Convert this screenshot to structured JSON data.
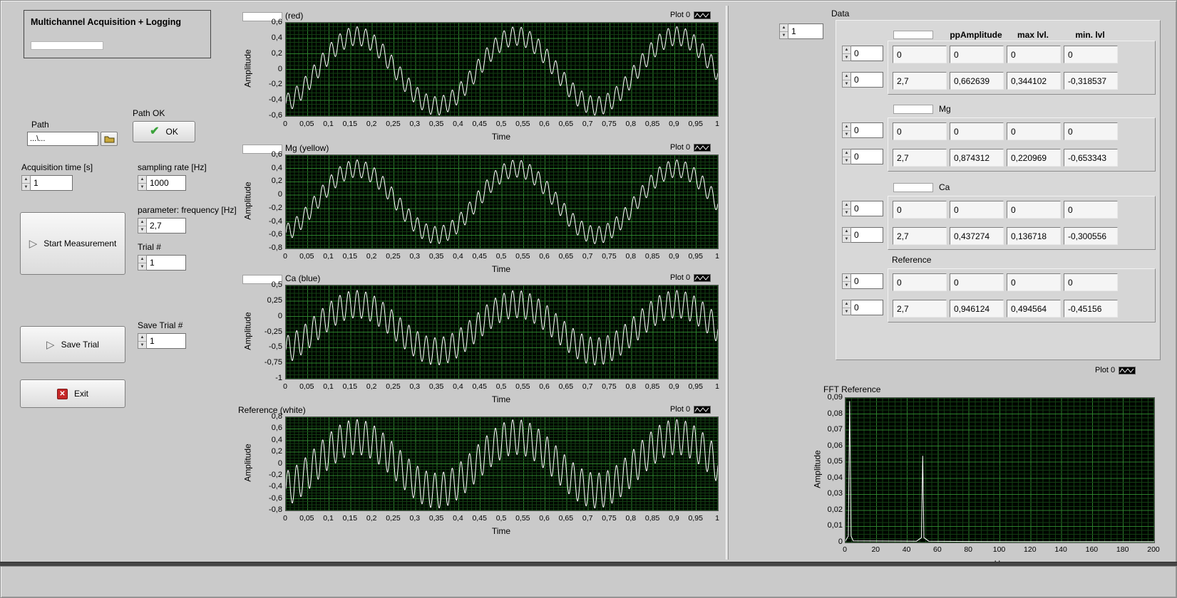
{
  "window": {
    "title": "Multichannel Acquisition + Logging"
  },
  "colors": {
    "panel_bg": "#cacaca",
    "plot_bg": "#000600",
    "grid_major": "#2c7e2c",
    "grid_minor": "#133d13",
    "waveform": "#ffffff",
    "exit_icon_red": "#c62828",
    "check_green": "#3aa23a"
  },
  "left_panel": {
    "path_label": "Path",
    "path_value": "...\\...",
    "path_ok_label": "Path OK",
    "ok_button_label": "OK",
    "acquisition_time_label": "Acquisition time [s]",
    "acquisition_time_value": "1",
    "sampling_rate_label": "sampling rate [Hz]",
    "sampling_rate_value": "1000",
    "frequency_label": "parameter: frequency [Hz]",
    "frequency_value": "2,7",
    "start_button_label": "Start Measurement",
    "trial_label": "Trial #",
    "trial_value": "1",
    "save_button_label": "Save Trial",
    "save_trial_label": "Save Trial #",
    "save_trial_value": "1",
    "exit_button_label": "Exit"
  },
  "data_panel": {
    "title": "Data",
    "channel_index_value": "1",
    "column_headers": [
      "ppAmplitude",
      "max lvl.",
      "min. lvl"
    ],
    "groups": [
      {
        "name": "",
        "name_box": false,
        "rows": [
          {
            "selector": "0",
            "values": [
              "0",
              "0",
              "0",
              "0"
            ]
          },
          {
            "selector": "0",
            "values": [
              "2,7",
              "0,662639",
              "0,344102",
              "-0,318537"
            ]
          }
        ]
      },
      {
        "name": "Mg",
        "name_box": true,
        "rows": [
          {
            "selector": "0",
            "values": [
              "0",
              "0",
              "0",
              "0"
            ]
          },
          {
            "selector": "0",
            "values": [
              "2,7",
              "0,874312",
              "0,220969",
              "-0,653343"
            ]
          }
        ]
      },
      {
        "name": "Ca",
        "name_box": true,
        "rows": [
          {
            "selector": "0",
            "values": [
              "0",
              "0",
              "0",
              "0"
            ]
          },
          {
            "selector": "0",
            "values": [
              "2,7",
              "0,437274",
              "0,136718",
              "-0,300556"
            ]
          }
        ]
      },
      {
        "name": "Reference",
        "name_box": false,
        "rows": [
          {
            "selector": "0",
            "values": [
              "0",
              "0",
              "0",
              "0"
            ]
          },
          {
            "selector": "0",
            "values": [
              "2,7",
              "0,946124",
              "0,494564",
              "-0,45156"
            ]
          }
        ]
      }
    ]
  },
  "chart_data": [
    {
      "id": "red-channel",
      "type": "line",
      "title": "(red)",
      "legend": "Plot 0",
      "xlabel": "Time",
      "ylabel": "Amplitude",
      "xlim": [
        0,
        1
      ],
      "ylim": [
        -0.6,
        0.6
      ],
      "ytick_labels": [
        "0,6",
        "0,4",
        "0,2",
        "0",
        "-0,2",
        "-0,4",
        "-0,6"
      ],
      "xtick_labels": [
        "0",
        "0,05",
        "0,1",
        "0,15",
        "0,2",
        "0,25",
        "0,3",
        "0,35",
        "0,4",
        "0,45",
        "0,5",
        "0,55",
        "0,6",
        "0,65",
        "0,7",
        "0,75",
        "0,8",
        "0,85",
        "0,9",
        "0,95",
        "1"
      ],
      "line_color": "#ffffff",
      "signal": {
        "f1": 2.7,
        "a1": 0.45,
        "phase1": -1.2,
        "f2": 50,
        "a2": 0.12,
        "offset": -0.02
      }
    },
    {
      "id": "mg-channel",
      "type": "line",
      "title": "Mg (yellow)",
      "legend": "Plot 0",
      "xlabel": "Time",
      "ylabel": "Amplitude",
      "xlim": [
        0,
        1
      ],
      "ylim": [
        -0.8,
        0.6
      ],
      "ytick_labels": [
        "0,6",
        "0,4",
        "0,2",
        "0",
        "-0,2",
        "-0,4",
        "-0,6",
        "-0,8"
      ],
      "xtick_labels": [
        "0",
        "0,05",
        "0,1",
        "0,15",
        "0,2",
        "0,25",
        "0,3",
        "0,35",
        "0,4",
        "0,45",
        "0,5",
        "0,55",
        "0,6",
        "0,65",
        "0,7",
        "0,75",
        "0,8",
        "0,85",
        "0,9",
        "0,95",
        "1"
      ],
      "line_color": "#ffffff",
      "signal": {
        "f1": 2.7,
        "a1": 0.5,
        "phase1": -1.2,
        "f2": 50,
        "a2": 0.13,
        "offset": -0.1
      }
    },
    {
      "id": "ca-channel",
      "type": "line",
      "title": "Ca (blue)",
      "legend": "Plot 0",
      "xlabel": "Time",
      "ylabel": "Amplitude",
      "xlim": [
        0,
        1
      ],
      "ylim": [
        -1,
        0.5
      ],
      "ytick_labels": [
        "0,5",
        "0,25",
        "0",
        "-0,25",
        "-0,5",
        "-0,75",
        "-1"
      ],
      "xtick_labels": [
        "0",
        "0,05",
        "0,1",
        "0,15",
        "0,2",
        "0,25",
        "0,3",
        "0,35",
        "0,4",
        "0,45",
        "0,5",
        "0,55",
        "0,6",
        "0,65",
        "0,7",
        "0,75",
        "0,8",
        "0,85",
        "0,9",
        "0,95",
        "1"
      ],
      "line_color": "#ffffff",
      "signal": {
        "f1": 2.7,
        "a1": 0.38,
        "phase1": -1.2,
        "f2": 50,
        "a2": 0.22,
        "offset": -0.18
      }
    },
    {
      "id": "reference-channel",
      "type": "line",
      "title": "Reference (white)",
      "legend": "Plot 0",
      "xlabel": "Time",
      "ylabel": "Amplitude",
      "xlim": [
        0,
        1
      ],
      "ylim": [
        -0.8,
        0.8
      ],
      "ytick_labels": [
        "0,8",
        "0,6",
        "0,4",
        "0,2",
        "0",
        "-0,2",
        "-0,4",
        "-0,6",
        "-0,8"
      ],
      "xtick_labels": [
        "0",
        "0,05",
        "0,1",
        "0,15",
        "0,2",
        "0,25",
        "0,3",
        "0,35",
        "0,4",
        "0,45",
        "0,5",
        "0,55",
        "0,6",
        "0,65",
        "0,7",
        "0,75",
        "0,8",
        "0,85",
        "0,9",
        "0,95",
        "1"
      ],
      "line_color": "#ffffff",
      "signal": {
        "f1": 2.7,
        "a1": 0.46,
        "phase1": -1.2,
        "f2": 50,
        "a2": 0.3,
        "offset": 0
      }
    },
    {
      "id": "fft-reference",
      "type": "line",
      "title": "FFT Reference",
      "legend": "Plot 0",
      "xlabel": "Hz",
      "ylabel": "Amplitude",
      "xlim": [
        0,
        200
      ],
      "ylim": [
        0,
        0.09
      ],
      "ytick_labels": [
        "0,09",
        "0,08",
        "0,07",
        "0,06",
        "0,05",
        "0,04",
        "0,03",
        "0,02",
        "0,01",
        "0"
      ],
      "xtick_labels": [
        "0",
        "20",
        "40",
        "60",
        "80",
        "100",
        "120",
        "140",
        "160",
        "180",
        "200"
      ],
      "line_color": "#ffffff",
      "points": [
        [
          0,
          0.001
        ],
        [
          1.8,
          0.004
        ],
        [
          2.7,
          0.088
        ],
        [
          3.6,
          0.004
        ],
        [
          5,
          0.001
        ],
        [
          46,
          0.0008
        ],
        [
          49.2,
          0.003
        ],
        [
          50,
          0.054
        ],
        [
          50.8,
          0.003
        ],
        [
          54,
          0.0008
        ],
        [
          80,
          0.0006
        ],
        [
          120,
          0.0005
        ],
        [
          160,
          0.0005
        ],
        [
          200,
          0.0005
        ]
      ],
      "peaks": [
        {
          "hz": 2.7,
          "amplitude": 0.088
        },
        {
          "hz": 50,
          "amplitude": 0.054
        }
      ]
    }
  ]
}
